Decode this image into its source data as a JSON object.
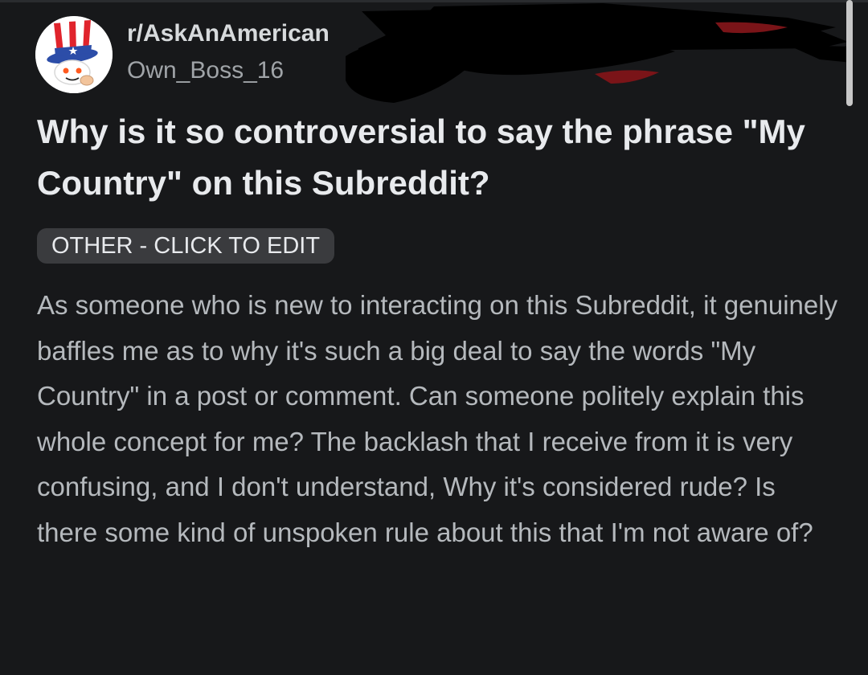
{
  "post": {
    "subreddit": "r/AskAnAmerican",
    "author": "Own_Boss_16",
    "title": "Why is it so controversial to say the phrase \"My Country\" on this Subreddit?",
    "flair": "OTHER - CLICK TO EDIT",
    "body": "As someone who is new to interacting on this Subreddit, it genuinely baffles me as to why it's such a big deal to say the words \"My Country\" in a post or comment. Can someone politely explain this whole concept for me? The backlash that I receive from it is very confusing, and I don't understand, Why it's considered rude? Is there some kind of unspoken rule about this that I'm not aware of?"
  },
  "icons": {
    "avatar": "uncle-sam-snoo-avatar-icon"
  },
  "colors": {
    "background": "#17181a",
    "title_text": "#e8eaed",
    "body_text": "#b5b9bd",
    "username_text": "#a0a4a8",
    "flair_background": "#3a3b3e"
  }
}
